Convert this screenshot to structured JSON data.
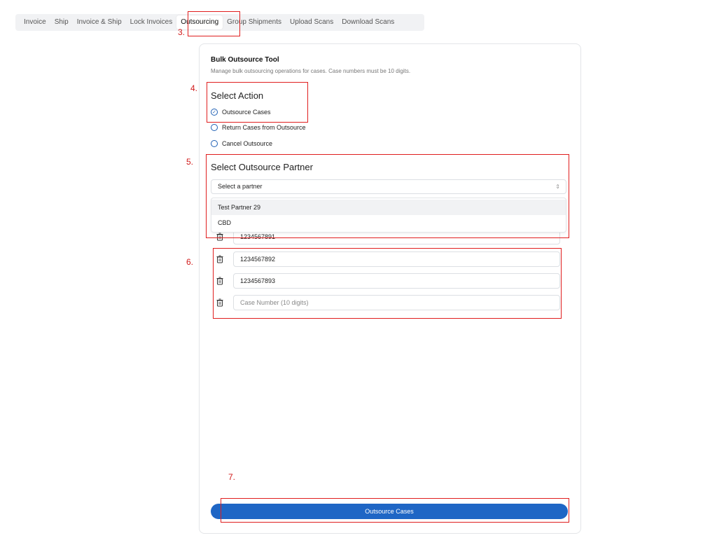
{
  "tabs": [
    {
      "label": "Invoice"
    },
    {
      "label": "Ship"
    },
    {
      "label": "Invoice & Ship"
    },
    {
      "label": "Lock Invoices"
    },
    {
      "label": "Outsourcing",
      "active": true
    },
    {
      "label": "Group Shipments"
    },
    {
      "label": "Upload Scans"
    },
    {
      "label": "Download Scans"
    }
  ],
  "card": {
    "title": "Bulk Outsource Tool",
    "description": "Manage bulk outsourcing operations for cases. Case numbers must be 10 digits."
  },
  "action_section": {
    "title": "Select Action",
    "options": [
      {
        "label": "Outsource Cases",
        "selected": true
      },
      {
        "label": "Return Cases from Outsource",
        "selected": false
      },
      {
        "label": "Cancel Outsource",
        "selected": false
      }
    ]
  },
  "partner_section": {
    "title": "Select Outsource Partner",
    "select_value": "Select a partner",
    "dropdown_options": [
      "Test Partner 29",
      "CBD"
    ]
  },
  "cases": {
    "values": [
      "1234567891",
      "1234567892",
      "1234567893"
    ],
    "placeholder": "Case Number (10 digits)"
  },
  "submit_label": "Outsource Cases",
  "annotations": [
    "3.",
    "4.",
    "5.",
    "6.",
    "7."
  ],
  "colors": {
    "accent": "#1f66c5",
    "annotation": "#e01e1e"
  }
}
